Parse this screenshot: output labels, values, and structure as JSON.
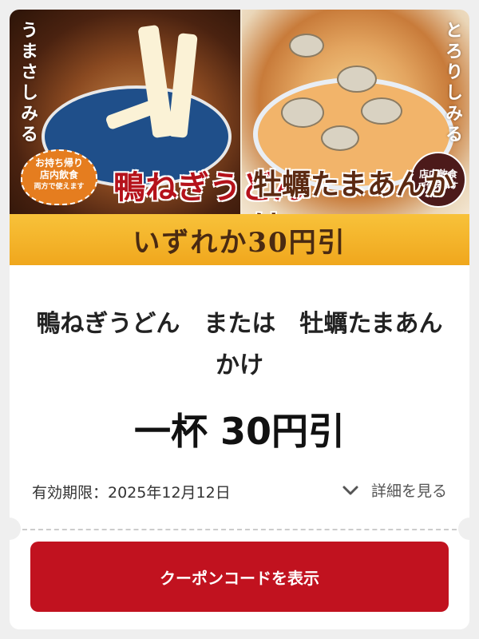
{
  "banner": {
    "left_tagline": "うまさしみる",
    "right_tagline": "とろりしみる",
    "left_badge_line1": "お持ち帰り",
    "left_badge_line2": "店内飲食",
    "left_badge_line3": "両方で使えます",
    "right_badge_line1": "店内飲食",
    "right_badge_line2": "で使えます",
    "left_title": "鴨ねぎうどん",
    "right_title": "牡蠣たまあんかけ",
    "discount": "いずれか30円引"
  },
  "coupon": {
    "product_name": "鴨ねぎうどん　または　牡蠣たまあんかけ",
    "offer": "一杯 30円引",
    "expiry": "有効期限：2025年12月12日",
    "details_label": "詳細を見る",
    "button_label": "クーポンコードを表示"
  },
  "colors": {
    "accent_red": "#c1121f",
    "band_yellow": "#f8c23a"
  },
  "icons": {
    "details_toggle": "chevron-down-icon"
  }
}
